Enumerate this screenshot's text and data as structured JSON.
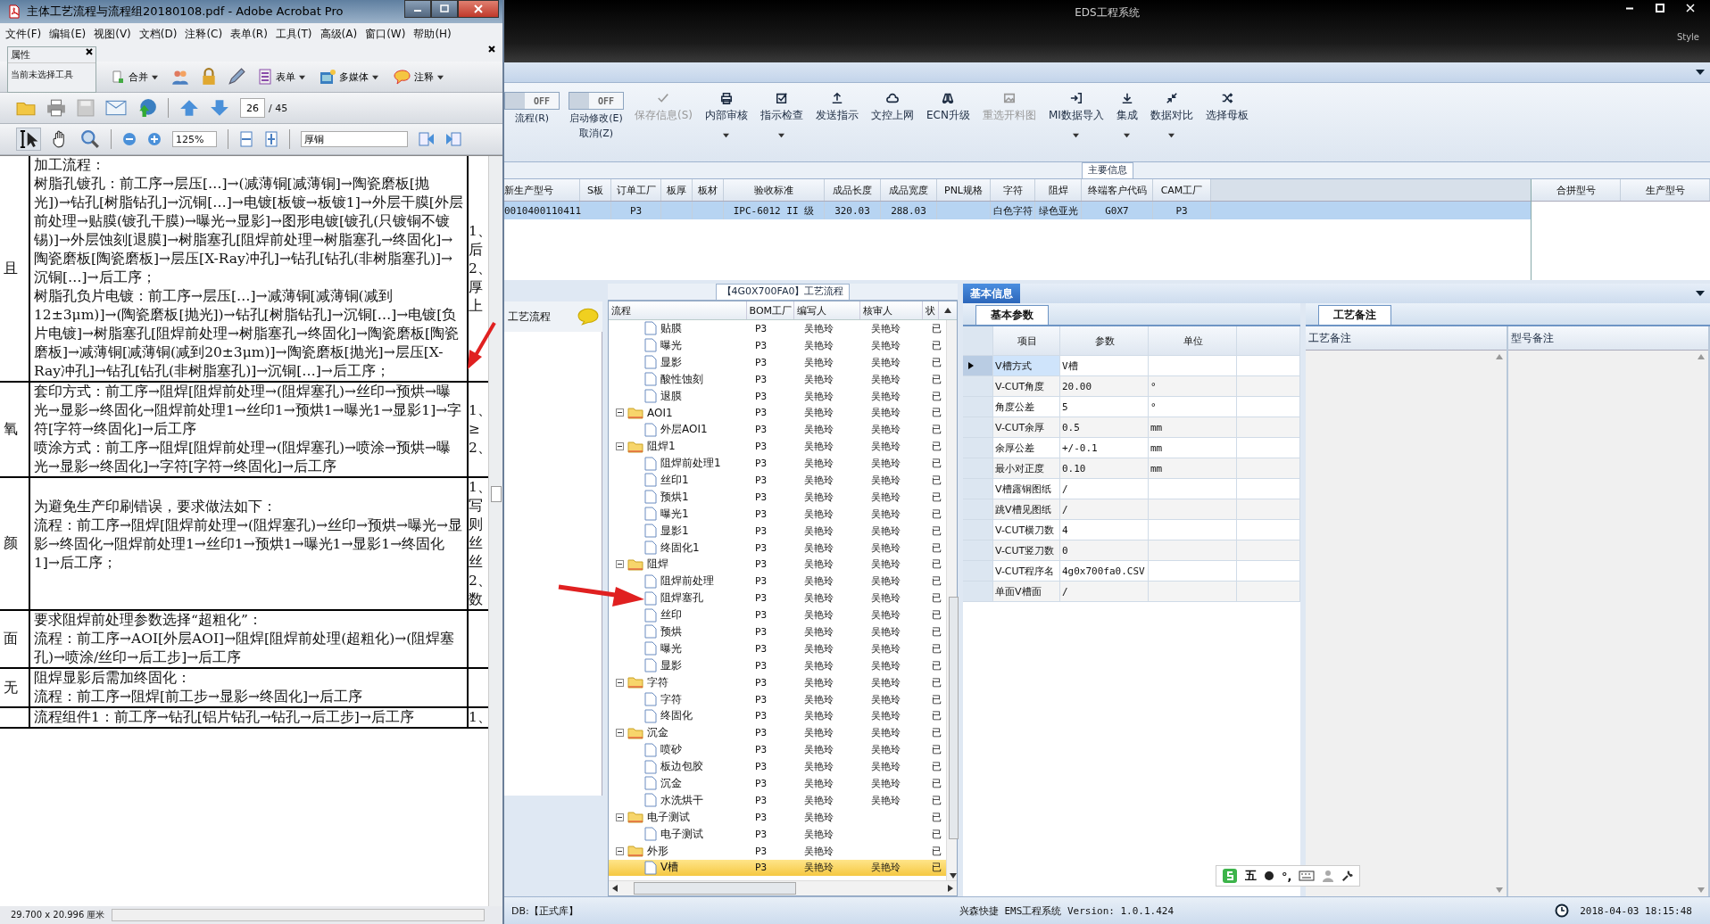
{
  "acrobat": {
    "title": "主体工艺流程与流程组20180108.pdf - Adobe Acrobat Pro",
    "menu": [
      "文件(F)",
      "编辑(E)",
      "视图(V)",
      "文档(D)",
      "注释(C)",
      "表单(R)",
      "工具(T)",
      "高级(A)",
      "窗口(W)",
      "帮助(H)"
    ],
    "properties_panel": {
      "title": "属性",
      "text": "当前未选择工具"
    },
    "toolbar_labels": [
      "合并",
      "表单",
      "多媒体",
      "注释"
    ],
    "page": {
      "current": "26",
      "total": "/ 45"
    },
    "zoom": "125%",
    "search": "厚铜",
    "document": {
      "rows": [
        {
          "left": "且",
          "body": [
            "加工流程：",
            "树脂孔镀孔：前工序→层压[…]→(减薄铜[减薄铜]→陶瓷磨板[抛光])→钻孔[树脂钻孔]→沉铜[…]→电镀[板镀→板镀1]→外层干膜[外层前处理→贴膜(镀孔干膜)→曝光→显影]→图形电镀[镀孔(只镀铜不镀锡)]→外层蚀刻[退膜]→树脂塞孔[阻焊前处理→树脂塞孔→终固化]→陶瓷磨板[陶瓷磨板]→层压[X-Ray冲孔]→钻孔[钻孔(非树脂塞孔)]→沉铜[…]→后工序；",
            "树脂孔负片电镀：前工序→层压[…]→减薄铜[减薄铜(减到12±3μm)]→(陶瓷磨板[抛光])→钻孔[树脂钻孔]→沉铜[…]→电镀[负片电镀]→树脂塞孔[阻焊前处理→树脂塞孔→终固化]→陶瓷磨板[陶瓷磨板]→减薄铜[减薄铜(减到20±3μm)]→陶瓷磨板[抛光]→层压[X-Ray冲孔]→钻孔[钻孔(非树脂塞孔)]→沉铜[…]→后工序；"
          ],
          "right": [
            "1、",
            "后",
            "2、",
            "厚",
            "上"
          ]
        },
        {
          "left": "氧",
          "body": [
            "套印方式：前工序→阻焊[阻焊前处理→(阻焊塞孔)→丝印→预烘→曝光→显影→终固化→阻焊前处理1→丝印1→预烘1→曝光1→显影1]→字符[字符→终固化]→后工序",
            "喷涂方式：前工序→阻焊[阻焊前处理→(阻焊塞孔)→喷涂→预烘→曝光→显影→终固化]→字符[字符→终固化]→后工序"
          ],
          "right": [
            "1、",
            "≥",
            "2、"
          ]
        },
        {
          "left": "颜",
          "body": [
            "为避免生产印刷错误，要求做法如下：",
            "流程：前工序→阻焊[阻焊前处理→(阻焊塞孔)→丝印→预烘→曝光→显影→终固化→阻焊前处理1→丝印1→预烘1→曝光1→显影1→终固化1]→后工序；"
          ],
          "right": [
            "1、",
            "写",
            "则",
            "丝",
            "丝",
            "2、",
            "数"
          ]
        },
        {
          "left": "面",
          "body": [
            "要求阻焊前处理参数选择“超粗化”：",
            "流程：前工序→AOI[外层AOI]→阻焊[阻焊前处理(超粗化)→(阻焊塞孔)→喷涂/丝印→后工步]→后工序"
          ]
        },
        {
          "left": "无",
          "body": [
            "阻焊显影后需加终固化：",
            "流程：前工序→阻焊[前工步→显影→终固化]→后工序"
          ]
        },
        {
          "body": [
            "流程组件1：前工序→钻孔[铝片钻孔→钻孔→后工步]→后工序"
          ],
          "right": [
            "1、"
          ]
        }
      ]
    },
    "status": "29.700 x 20.996 厘米"
  },
  "eds": {
    "title": "EDS工程系统",
    "style_label": "Style",
    "toggles": [
      {
        "state": "OFF",
        "on": false,
        "label": "流程(R)"
      },
      {
        "state": "OFF",
        "on": false,
        "label": "启动修改(E)",
        "sublabel": "取消(Z)"
      }
    ],
    "toolbar": [
      {
        "label": "保存信息(S)",
        "disabled": true,
        "dropdown": false
      },
      {
        "label": "内部审核",
        "disabled": false,
        "dropdown": true
      },
      {
        "label": "指示检查",
        "disabled": false,
        "dropdown": true
      },
      {
        "label": "发送指示",
        "disabled": false,
        "dropdown": false
      },
      {
        "label": "文控上网",
        "disabled": false,
        "dropdown": false
      },
      {
        "label": "ECN升级",
        "disabled": false,
        "dropdown": false
      },
      {
        "label": "重选开料图",
        "disabled": true,
        "dropdown": false
      },
      {
        "label": "MI数据导入",
        "disabled": false,
        "dropdown": true
      },
      {
        "label": "集成",
        "disabled": false,
        "dropdown": true
      },
      {
        "label": "数据对比",
        "disabled": false,
        "dropdown": true
      },
      {
        "label": "选择母板",
        "disabled": false,
        "dropdown": false
      }
    ],
    "main_info": {
      "title": "主要信息",
      "columns": [
        "新生产型号",
        "S板",
        "订单工厂",
        "板厚",
        "板材",
        "验收标准",
        "成品长度",
        "成品宽度",
        "PNL规格",
        "字符",
        "阻焊",
        "终端客户代码",
        "CAM工厂"
      ],
      "rows": [
        {
          "selected": true,
          "cells": [
            "0010400110411",
            null,
            "P3",
            null,
            null,
            "IPC-6012 II 级",
            "320.03",
            "288.03",
            null,
            "白色字符",
            "绿色亚光",
            "G0X7",
            "P3"
          ]
        }
      ],
      "side_columns": [
        "合拼型号",
        "生产型号"
      ]
    },
    "left_panel": {
      "title": "工艺流程"
    },
    "process_tree": {
      "title": "【4G0X700FA0】工艺流程",
      "columns": [
        "流程",
        "BOM工厂",
        "编写人",
        "核审人",
        "状"
      ],
      "nodes": [
        {
          "kind": "file",
          "label": "贴膜",
          "bom": "P3",
          "writer": "吴艳玲",
          "reviewer": "吴艳玲",
          "status": "已",
          "selected": false
        },
        {
          "kind": "file",
          "label": "曝光",
          "bom": "P3",
          "writer": "吴艳玲",
          "reviewer": "吴艳玲",
          "status": "已",
          "selected": false
        },
        {
          "kind": "file",
          "label": "显影",
          "bom": "P3",
          "writer": "吴艳玲",
          "reviewer": "吴艳玲",
          "status": "已",
          "selected": false
        },
        {
          "kind": "file",
          "label": "酸性蚀刻",
          "bom": "P3",
          "writer": "吴艳玲",
          "reviewer": "吴艳玲",
          "status": "已",
          "selected": false
        },
        {
          "kind": "file",
          "label": "退膜",
          "bom": "P3",
          "writer": "吴艳玲",
          "reviewer": "吴艳玲",
          "status": "已",
          "selected": false
        },
        {
          "kind": "folder",
          "label": "AOI1",
          "bom": "P3",
          "writer": "吴艳玲",
          "reviewer": "吴艳玲",
          "status": "已",
          "selected": false,
          "expanded": true,
          "children": [
            {
              "kind": "file",
              "label": "外层AOI1",
              "bom": "P3",
              "writer": "吴艳玲",
              "reviewer": "吴艳玲",
              "status": "已",
              "selected": false
            }
          ]
        },
        {
          "kind": "folder",
          "label": "阻焊1",
          "bom": "P3",
          "writer": "吴艳玲",
          "reviewer": "吴艳玲",
          "status": "已",
          "selected": false,
          "expanded": true,
          "children": [
            {
              "kind": "file",
              "label": "阻焊前处理1",
              "bom": "P3",
              "writer": "吴艳玲",
              "reviewer": "吴艳玲",
              "status": "已",
              "selected": false
            },
            {
              "kind": "file",
              "label": "丝印1",
              "bom": "P3",
              "writer": "吴艳玲",
              "reviewer": "吴艳玲",
              "status": "已",
              "selected": false
            },
            {
              "kind": "file",
              "label": "预烘1",
              "bom": "P3",
              "writer": "吴艳玲",
              "reviewer": "吴艳玲",
              "status": "已",
              "selected": false
            },
            {
              "kind": "file",
              "label": "曝光1",
              "bom": "P3",
              "writer": "吴艳玲",
              "reviewer": "吴艳玲",
              "status": "已",
              "selected": false
            },
            {
              "kind": "file",
              "label": "显影1",
              "bom": "P3",
              "writer": "吴艳玲",
              "reviewer": "吴艳玲",
              "status": "已",
              "selected": false
            },
            {
              "kind": "file",
              "label": "终固化1",
              "bom": "P3",
              "writer": "吴艳玲",
              "reviewer": "吴艳玲",
              "status": "已",
              "selected": false
            }
          ]
        },
        {
          "kind": "folder",
          "label": "阻焊",
          "bom": "P3",
          "writer": "吴艳玲",
          "reviewer": "吴艳玲",
          "status": "已",
          "selected": false,
          "expanded": true,
          "children": [
            {
              "kind": "file",
              "label": "阻焊前处理",
              "bom": "P3",
              "writer": "吴艳玲",
              "reviewer": "吴艳玲",
              "status": "已",
              "selected": false
            },
            {
              "kind": "file",
              "label": "阻焊塞孔",
              "bom": "P3",
              "writer": "吴艳玲",
              "reviewer": "吴艳玲",
              "status": "已",
              "selected": false
            },
            {
              "kind": "file",
              "label": "丝印",
              "bom": "P3",
              "writer": "吴艳玲",
              "reviewer": "吴艳玲",
              "status": "已",
              "selected": false
            },
            {
              "kind": "file",
              "label": "预烘",
              "bom": "P3",
              "writer": "吴艳玲",
              "reviewer": "吴艳玲",
              "status": "已",
              "selected": false
            },
            {
              "kind": "file",
              "label": "曝光",
              "bom": "P3",
              "writer": "吴艳玲",
              "reviewer": "吴艳玲",
              "status": "已",
              "selected": false
            },
            {
              "kind": "file",
              "label": "显影",
              "bom": "P3",
              "writer": "吴艳玲",
              "reviewer": "吴艳玲",
              "status": "已",
              "selected": false
            }
          ]
        },
        {
          "kind": "folder",
          "label": "字符",
          "bom": "P3",
          "writer": "吴艳玲",
          "reviewer": "吴艳玲",
          "status": "已",
          "selected": false,
          "expanded": true,
          "children": [
            {
              "kind": "file",
              "label": "字符",
              "bom": "P3",
              "writer": "吴艳玲",
              "reviewer": "吴艳玲",
              "status": "已",
              "selected": false
            },
            {
              "kind": "file",
              "label": "终固化",
              "bom": "P3",
              "writer": "吴艳玲",
              "reviewer": "吴艳玲",
              "status": "已",
              "selected": false
            }
          ]
        },
        {
          "kind": "folder",
          "label": "沉金",
          "bom": "P3",
          "writer": "吴艳玲",
          "reviewer": "吴艳玲",
          "status": "已",
          "selected": false,
          "expanded": true,
          "children": [
            {
              "kind": "file",
              "label": "喷砂",
              "bom": "P3",
              "writer": "吴艳玲",
              "reviewer": "吴艳玲",
              "status": "已",
              "selected": false
            },
            {
              "kind": "file",
              "label": "板边包胶",
              "bom": "P3",
              "writer": "吴艳玲",
              "reviewer": "吴艳玲",
              "status": "已",
              "selected": false
            },
            {
              "kind": "file",
              "label": "沉金",
              "bom": "P3",
              "writer": "吴艳玲",
              "reviewer": "吴艳玲",
              "status": "已",
              "selected": false
            },
            {
              "kind": "file",
              "label": "水洗烘干",
              "bom": "P3",
              "writer": "吴艳玲",
              "reviewer": "吴艳玲",
              "status": "已",
              "selected": false
            }
          ]
        },
        {
          "kind": "folder",
          "label": "电子测试",
          "bom": "P3",
          "writer": "吴艳玲",
          "status": "已",
          "selected": false,
          "expanded": true,
          "children": [
            {
              "kind": "file",
              "label": "电子测试",
              "bom": "P3",
              "writer": "吴艳玲",
              "status": "已",
              "selected": false
            }
          ]
        },
        {
          "kind": "folder",
          "label": "外形",
          "bom": "P3",
          "writer": "吴艳玲",
          "status": "已",
          "selected": false,
          "expanded": true,
          "children": [
            {
              "kind": "file",
              "label": "V槽",
              "bom": "P3",
              "writer": "吴艳玲",
              "reviewer": "吴艳玲",
              "status": "已",
              "selected": true
            }
          ]
        }
      ]
    },
    "basic_info": {
      "tab": "基本信息",
      "subtab": "基本参数",
      "columns": [
        "项目",
        "参数",
        "单位"
      ],
      "rows": [
        {
          "item": "V槽方式",
          "value": "V槽",
          "selected": true
        },
        {
          "item": "V-CUT角度",
          "value": "20.00",
          "unit": "°",
          "selected": false
        },
        {
          "item": "角度公差",
          "value": "5",
          "unit": "°",
          "selected": false
        },
        {
          "item": "V-CUT余厚",
          "value": "0.5",
          "unit": "mm",
          "selected": false
        },
        {
          "item": "余厚公差",
          "value": "+/-0.1",
          "unit": "mm",
          "selected": false
        },
        {
          "item": "最小对正度",
          "value": "0.10",
          "unit": "mm",
          "selected": false
        },
        {
          "item": "V槽露铜图纸",
          "value": "/",
          "selected": false
        },
        {
          "item": "跳V槽见图纸",
          "value": "/",
          "selected": false
        },
        {
          "item": "V-CUT横刀数",
          "value": "4",
          "selected": false
        },
        {
          "item": "V-CUT竖刀数",
          "value": "0",
          "selected": false
        },
        {
          "item": "V-CUT程序名",
          "value": "4g0x700fa0.CSV",
          "selected": false
        },
        {
          "item": "单面V槽面",
          "value": "/",
          "selected": false
        }
      ]
    },
    "notes": {
      "tab": "工艺备注",
      "columns": [
        "工艺备注",
        "型号备注"
      ]
    },
    "ime": {
      "text": "五",
      "punct": "°,"
    },
    "status_bar": {
      "db": "DB:【正式库】",
      "version": "兴森快捷 EMS工程系统 Version: 1.0.1.424",
      "time": "2018-04-03 18:15:48"
    }
  }
}
